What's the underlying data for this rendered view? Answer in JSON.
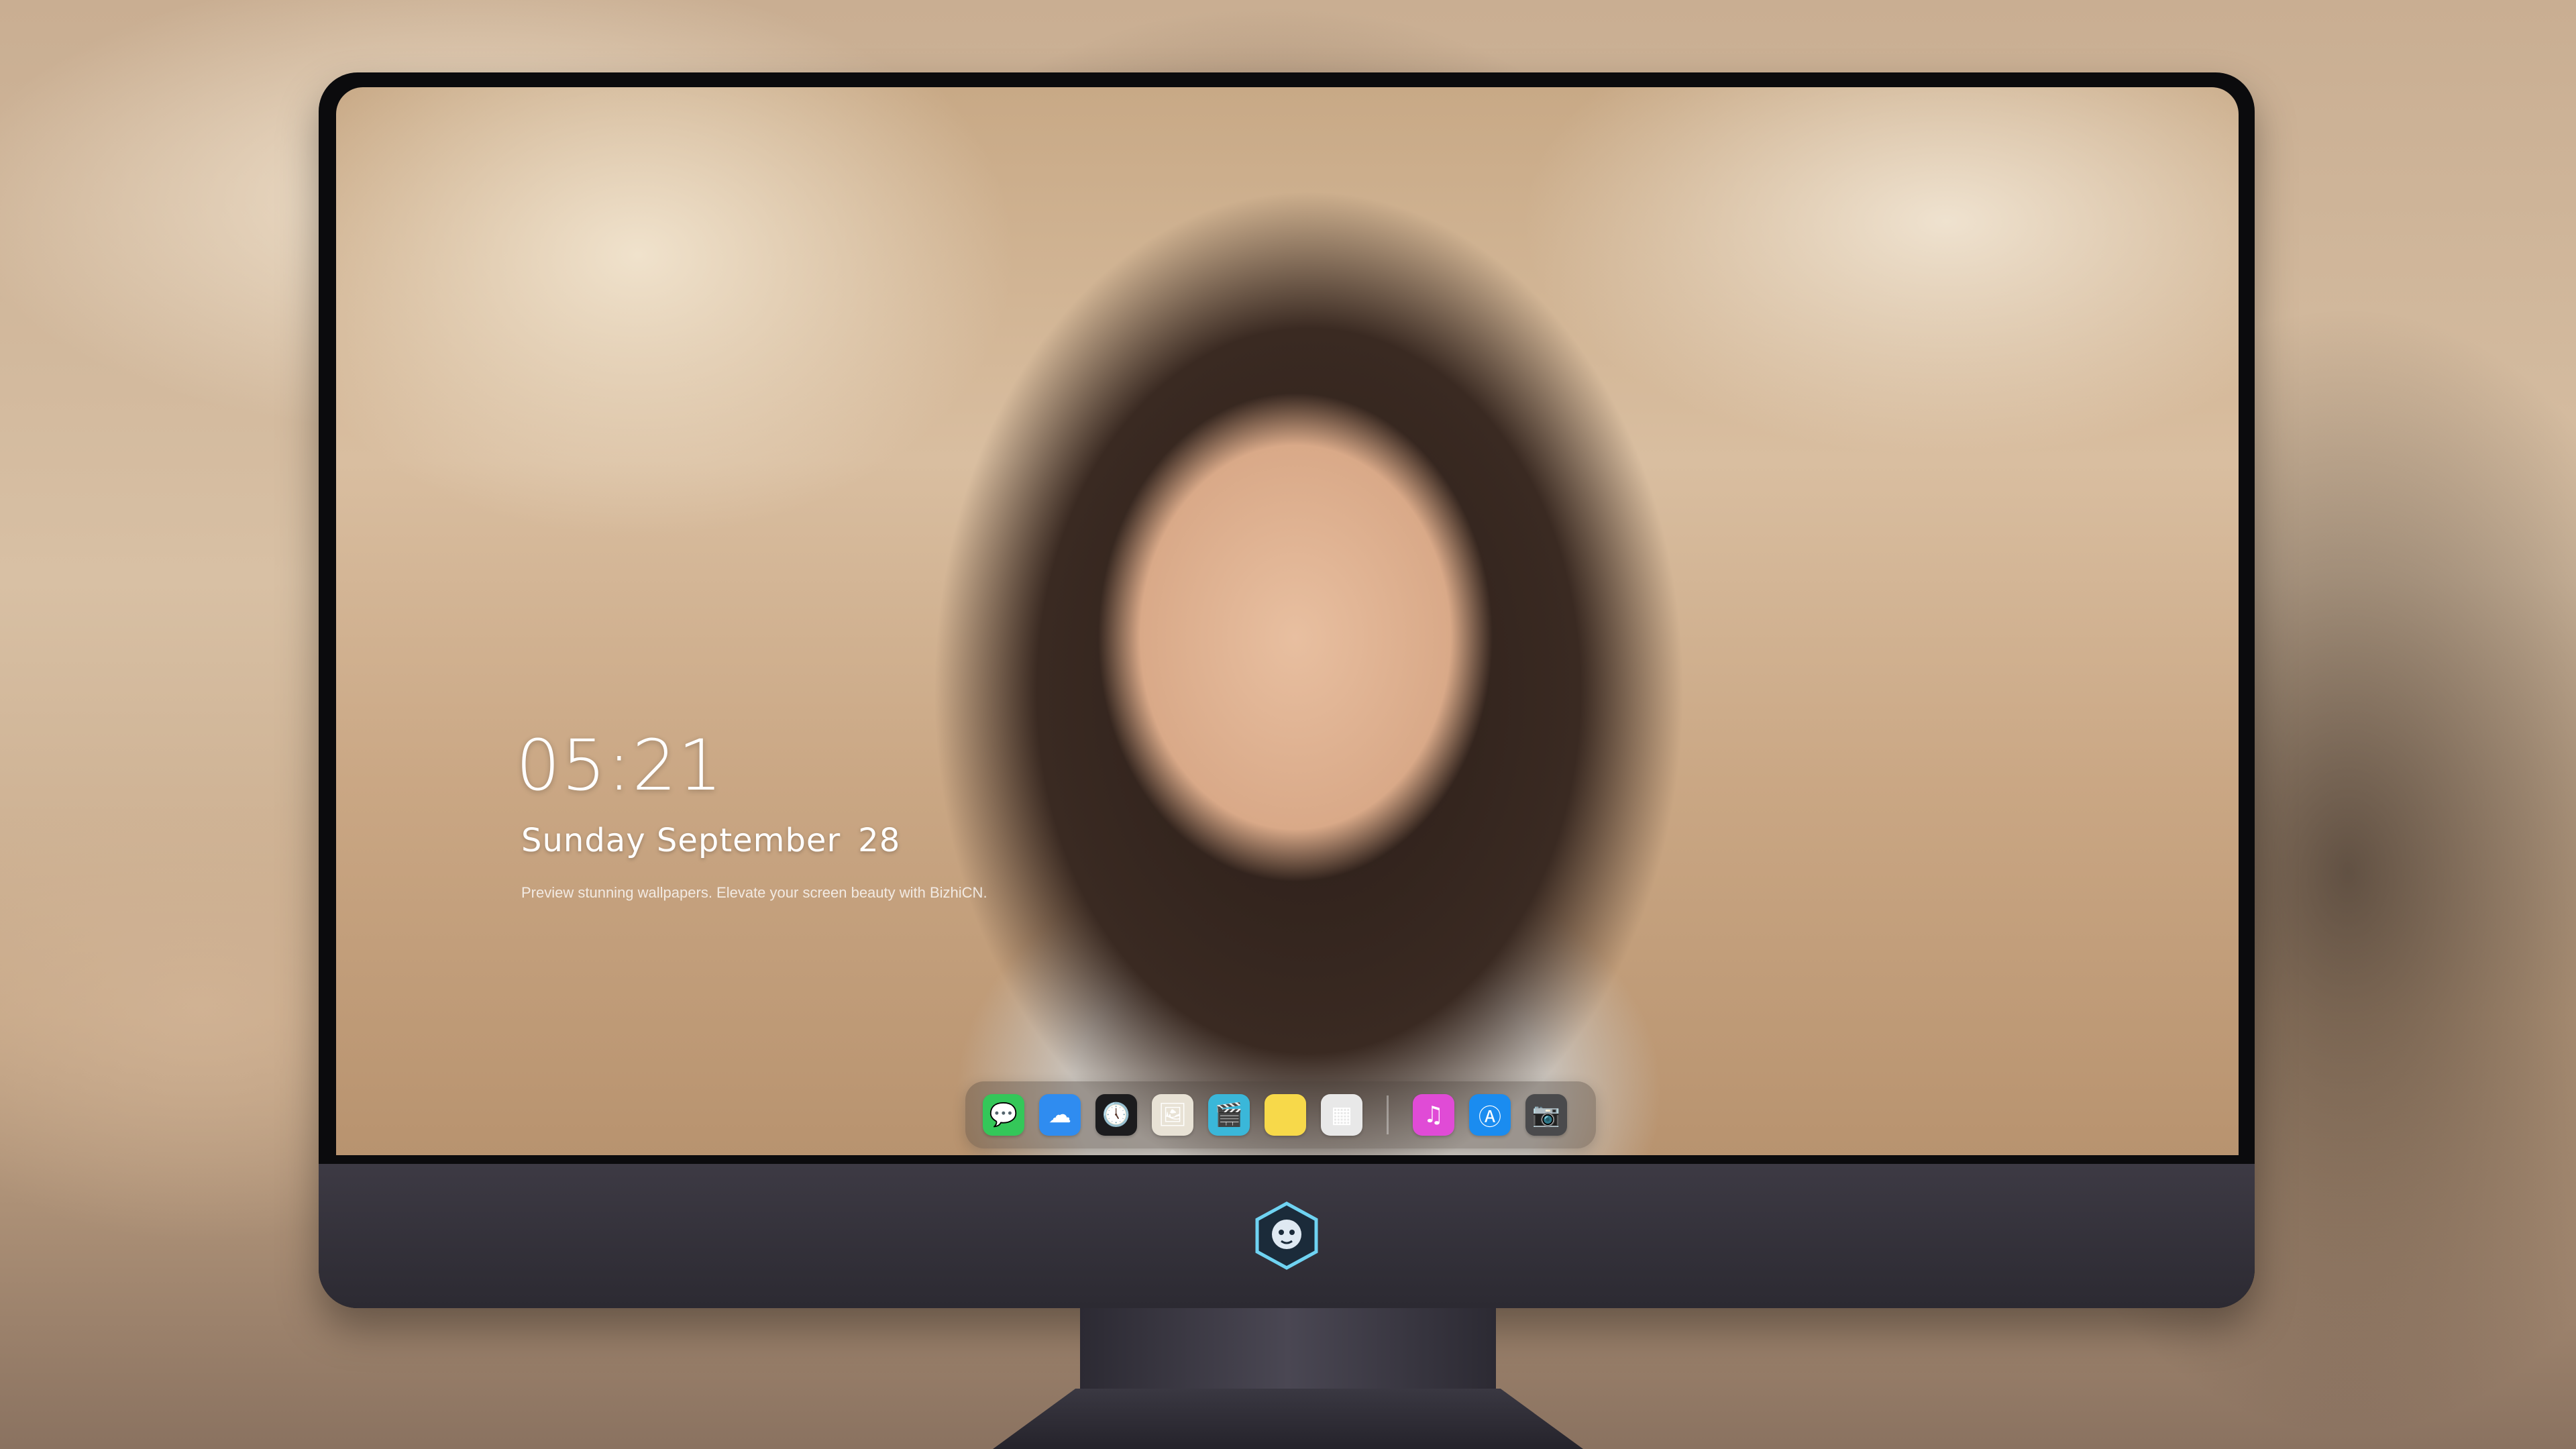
{
  "lock_screen": {
    "time": "05:21",
    "weekday_month": "Sunday September",
    "day": "28",
    "tagline": "Preview stunning wallpapers. Elevate your screen beauty with BizhiCN."
  },
  "dock": {
    "apps": [
      {
        "name": "messages-icon",
        "glyph": "💬",
        "color": "#34c759"
      },
      {
        "name": "weather-icon",
        "glyph": "☁",
        "color": "#2f8cf0"
      },
      {
        "name": "clock-icon",
        "glyph": "🕔",
        "color": "#1c1c1e"
      },
      {
        "name": "preview-icon",
        "glyph": "🖼",
        "color": "#e8e2d5"
      },
      {
        "name": "clips-icon",
        "glyph": "🎬",
        "color": "#3ab7d9"
      },
      {
        "name": "notes-icon",
        "glyph": "",
        "color": "#f7d94a"
      },
      {
        "name": "photos-icon",
        "glyph": "▦",
        "color": "#e8e8e8"
      },
      {
        "name": "music-icon",
        "glyph": "♫",
        "color": "#e04bd6"
      },
      {
        "name": "app-store-icon",
        "glyph": "Ⓐ",
        "color": "#1a8cf0"
      },
      {
        "name": "camera-icon",
        "glyph": "📷",
        "color": "#4a4a4c"
      }
    ]
  }
}
